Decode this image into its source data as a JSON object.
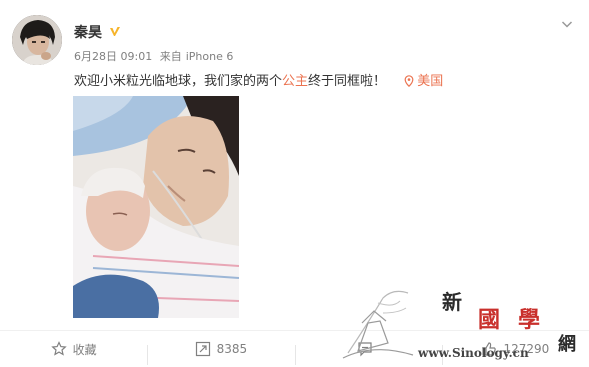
{
  "user": {
    "name": "秦昊",
    "verified_icon": "verified-v-badge"
  },
  "meta": {
    "date": "6月28日 09:01",
    "source_prefix": "来自",
    "source": "iPhone 6"
  },
  "post": {
    "text_before": "欢迎小米粒光临地球，我们家的两个",
    "highlight": "公主",
    "text_after": "终于同框啦！",
    "location": "美国",
    "highlight_color": "#eb7350"
  },
  "toolbar": {
    "favorite_label": "收藏",
    "repost_count": "8385",
    "comment_count": "",
    "like_count": "127290"
  },
  "watermark": {
    "char1": "新",
    "char2": "國",
    "char3": "學",
    "char4": "網",
    "url": "www.Sinology.cn"
  }
}
